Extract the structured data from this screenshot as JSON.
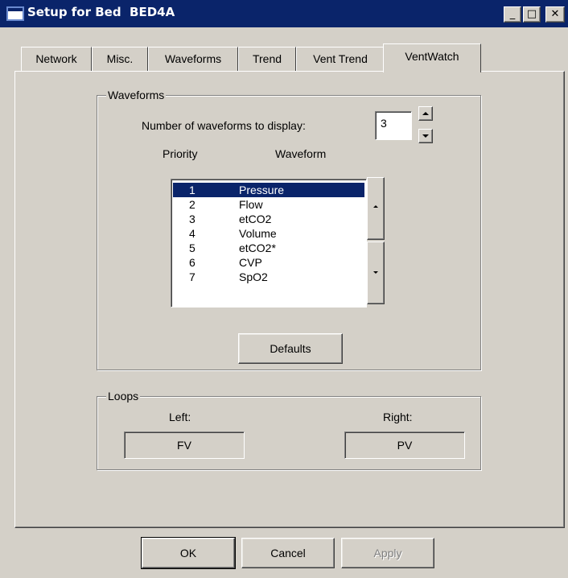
{
  "window": {
    "title": "Setup for Bed  BED4A",
    "minimize_glyph": "_",
    "maximize_glyph": "□",
    "close_glyph": "✕"
  },
  "tabs": [
    {
      "label": "Network"
    },
    {
      "label": "Misc."
    },
    {
      "label": "Waveforms"
    },
    {
      "label": "Trend"
    },
    {
      "label": "Vent Trend"
    },
    {
      "label": "VentWatch",
      "active": true
    }
  ],
  "waveforms_group": {
    "title": "Waveforms",
    "count_label": "Number of waveforms to display:",
    "count_value": "3",
    "priority_header": "Priority",
    "waveform_header": "Waveform",
    "list": [
      {
        "priority": "1",
        "waveform": "Pressure",
        "selected": true
      },
      {
        "priority": "2",
        "waveform": "Flow"
      },
      {
        "priority": "3",
        "waveform": "etCO2"
      },
      {
        "priority": "4",
        "waveform": "Volume"
      },
      {
        "priority": "5",
        "waveform": "etCO2*"
      },
      {
        "priority": "6",
        "waveform": "CVP"
      },
      {
        "priority": "7",
        "waveform": "SpO2"
      }
    ],
    "defaults_label": "Defaults"
  },
  "loops_group": {
    "title": "Loops",
    "left_label": "Left:",
    "left_value": "FV",
    "right_label": "Right:",
    "right_value": "PV"
  },
  "footer": {
    "ok_label": "OK",
    "cancel_label": "Cancel",
    "apply_label": "Apply"
  },
  "colors": {
    "face": "#d4d0c8",
    "title_bar": "#0a246a",
    "selection": "#0a246a"
  }
}
